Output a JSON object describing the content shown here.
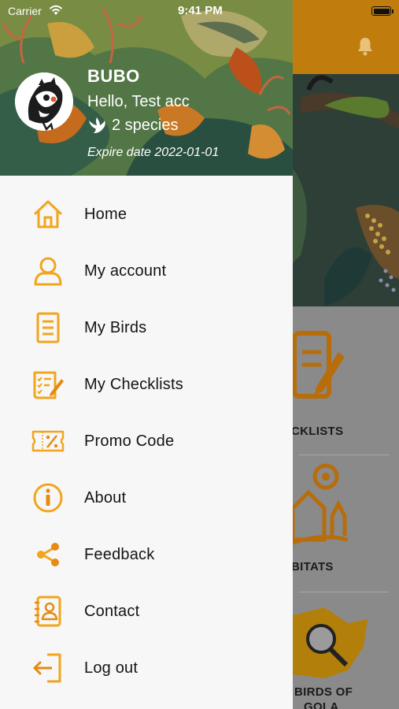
{
  "status_bar": {
    "carrier": "Carrier",
    "time": "9:41 PM"
  },
  "drawer": {
    "app_name": "BUBO",
    "greeting": "Hello, Test acc",
    "species": "2 species",
    "expire": "Expire date 2022-01-01",
    "menu": [
      {
        "label": "Home",
        "icon": "home-icon"
      },
      {
        "label": "My account",
        "icon": "user-icon"
      },
      {
        "label": "My Birds",
        "icon": "list-icon"
      },
      {
        "label": "My Checklists",
        "icon": "checklist-icon"
      },
      {
        "label": "Promo Code",
        "icon": "percent-ticket-icon"
      },
      {
        "label": "About",
        "icon": "info-icon"
      },
      {
        "label": "Feedback",
        "icon": "share-icon"
      },
      {
        "label": "Contact",
        "icon": "contact-book-icon"
      },
      {
        "label": "Log out",
        "icon": "logout-icon"
      }
    ]
  },
  "background": {
    "labels": [
      "CKLISTS",
      "BITATS",
      "BIRDS OF",
      "GOLA"
    ]
  },
  "colors": {
    "accent": "#f2a51c",
    "accent_dark": "#e58a12",
    "header_bar": "#c07d0e",
    "drawer_bg": "#f7f7f7"
  }
}
